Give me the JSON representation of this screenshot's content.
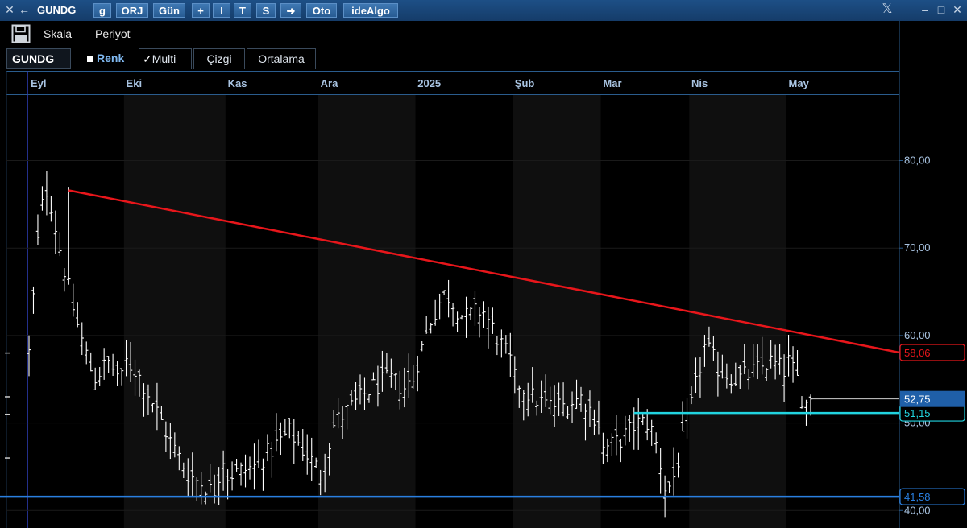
{
  "titlebar": {
    "close_glyph": "✕",
    "back_glyph": "←",
    "symbol": "GUNDG",
    "btn_g": "g",
    "btn_orj": "ORJ",
    "btn_period": "Gün",
    "btn_plus": "+",
    "btn_i": "I",
    "btn_t": "T",
    "btn_s": "S",
    "btn_arrow": "➜",
    "btn_oto": "Oto",
    "btn_idealgo": "ideAlgo",
    "x_logo": "𝕏",
    "min_glyph": "–",
    "max_glyph": "□",
    "win_close_glyph": "✕"
  },
  "toolbar": {
    "save_icon": "floppy-disk",
    "scale_label": "Skala",
    "period_label": "Periyot",
    "symbol_field": "GUNDG",
    "color_label": "Renk",
    "multi_label": "Multi",
    "multi_check": "✓",
    "line_label": "Çizgi",
    "average_label": "Ortalama"
  },
  "colors": {
    "background": "#000000",
    "bars": "#ffffff",
    "resistance_line": "#e8161b",
    "support_line": "#21d4e0",
    "floor_line": "#2a7fe0",
    "axis_text": "#a9c4e2",
    "current_price_bg": "#1f5fa8"
  },
  "chart_data": {
    "type": "ohlc",
    "symbol": "GUNDG",
    "x_labels": [
      "Eyl",
      "Eki",
      "Kas",
      "Ara",
      "2025",
      "Şub",
      "Mar",
      "Nis",
      "May"
    ],
    "y_ticks": [
      "80,00",
      "70,00",
      "60,00",
      "50,00",
      "40,00"
    ],
    "ylim": [
      38.0,
      87.5
    ],
    "segments": [
      {
        "month": "Eyl",
        "bars": 22,
        "path": [
          [
            0,
            58
          ],
          [
            0.12,
            74
          ],
          [
            0.2,
            77
          ],
          [
            0.35,
            69
          ],
          [
            0.5,
            62
          ],
          [
            0.7,
            55
          ],
          [
            0.85,
            57
          ],
          [
            1.0,
            55
          ]
        ]
      },
      {
        "month": "Eki",
        "bars": 23,
        "path": [
          [
            0,
            57
          ],
          [
            0.1,
            56
          ],
          [
            0.25,
            53
          ],
          [
            0.45,
            48
          ],
          [
            0.65,
            44
          ],
          [
            0.8,
            43
          ],
          [
            0.9,
            42
          ],
          [
            1.0,
            46
          ]
        ]
      },
      {
        "month": "Kas",
        "bars": 21,
        "path": [
          [
            0,
            44
          ],
          [
            0.3,
            45
          ],
          [
            0.5,
            47
          ],
          [
            0.7,
            49
          ],
          [
            0.85,
            47
          ],
          [
            1.0,
            45
          ]
        ]
      },
      {
        "month": "Ara",
        "bars": 22,
        "path": [
          [
            0,
            44
          ],
          [
            0.15,
            50
          ],
          [
            0.35,
            52
          ],
          [
            0.55,
            54
          ],
          [
            0.75,
            55
          ],
          [
            0.9,
            54
          ],
          [
            1.0,
            55
          ]
        ]
      },
      {
        "month": "2025",
        "bars": 22,
        "path": [
          [
            0,
            57
          ],
          [
            0.15,
            62
          ],
          [
            0.3,
            65
          ],
          [
            0.5,
            62
          ],
          [
            0.7,
            63
          ],
          [
            0.85,
            60
          ],
          [
            1.0,
            57
          ]
        ]
      },
      {
        "month": "Şub",
        "bars": 20,
        "path": [
          [
            0,
            55
          ],
          [
            0.2,
            53
          ],
          [
            0.4,
            52
          ],
          [
            0.6,
            52
          ],
          [
            0.8,
            53
          ],
          [
            1.0,
            50
          ]
        ]
      },
      {
        "month": "Mar",
        "bars": 20,
        "path": [
          [
            0,
            47
          ],
          [
            0.2,
            48
          ],
          [
            0.4,
            50
          ],
          [
            0.55,
            50
          ],
          [
            0.65,
            47
          ],
          [
            0.75,
            42
          ],
          [
            0.85,
            44
          ],
          [
            1.0,
            50
          ]
        ]
      },
      {
        "month": "Nis",
        "bars": 22,
        "path": [
          [
            0,
            52
          ],
          [
            0.15,
            59
          ],
          [
            0.3,
            56
          ],
          [
            0.5,
            55
          ],
          [
            0.7,
            56
          ],
          [
            0.85,
            57
          ],
          [
            1.0,
            56
          ]
        ]
      },
      {
        "month": "May",
        "bars": 6,
        "path": [
          [
            0,
            57
          ],
          [
            0.4,
            55
          ],
          [
            0.7,
            52
          ],
          [
            1.0,
            52.75
          ]
        ]
      }
    ],
    "lines": [
      {
        "name": "resistance",
        "from": {
          "bar": 9,
          "value": 76.6
        },
        "to": {
          "bar": "end",
          "value": 58.06
        },
        "label": "58,06"
      },
      {
        "name": "support",
        "from_bar": 137,
        "value": 51.15,
        "label": "51,15"
      },
      {
        "name": "floor",
        "from_bar": 0,
        "value": 41.58,
        "label": "41,58"
      }
    ],
    "current_price": "52,75",
    "price_extrema": {
      "high": 77,
      "low": 41.6
    }
  }
}
